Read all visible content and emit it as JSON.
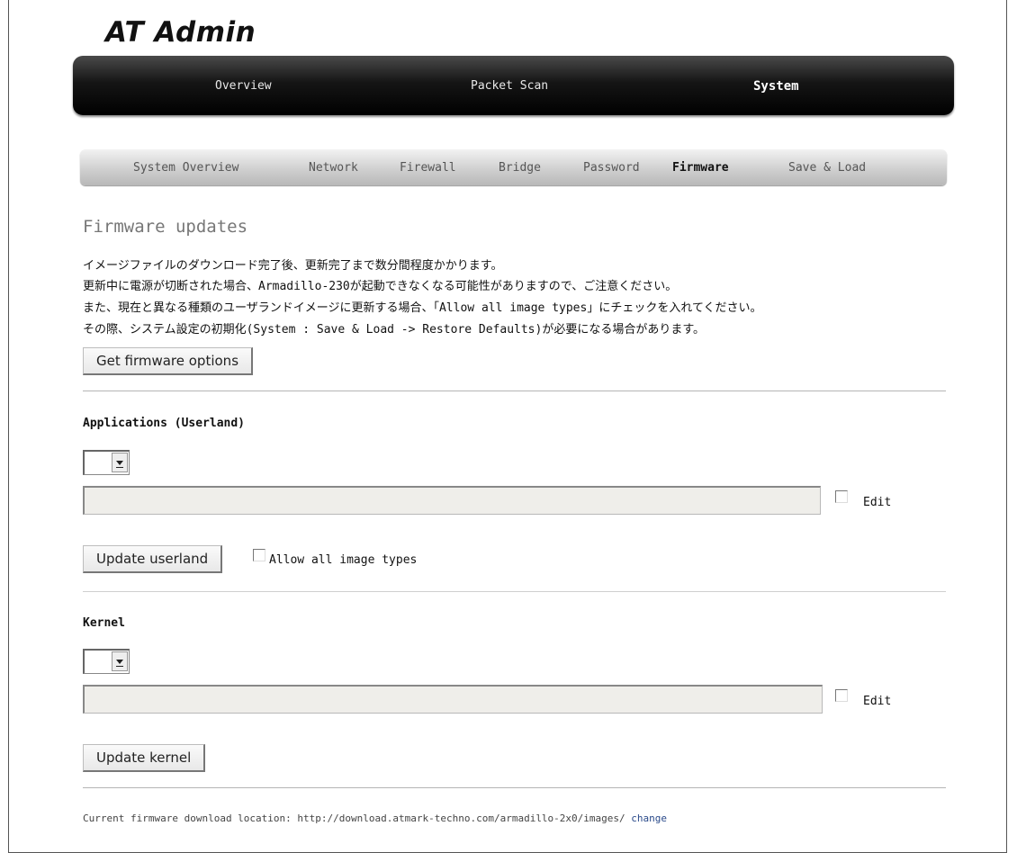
{
  "app": {
    "logo": "AT Admin"
  },
  "top_nav": [
    {
      "label": "Overview",
      "active": false
    },
    {
      "label": "Packet Scan",
      "active": false
    },
    {
      "label": "System",
      "active": true
    }
  ],
  "sub_nav": [
    {
      "label": "System Overview",
      "active": false
    },
    {
      "label": "Network",
      "active": false
    },
    {
      "label": "Firewall",
      "active": false
    },
    {
      "label": "Bridge",
      "active": false
    },
    {
      "label": "Password",
      "active": false
    },
    {
      "label": "Firmware",
      "active": true
    },
    {
      "label": "Save & Load",
      "active": false
    }
  ],
  "firmware": {
    "title": "Firmware updates",
    "description": [
      "イメージファイルのダウンロード完了後、更新完了まで数分間程度かかります。",
      "更新中に電源が切断された場合、Armadillo-230が起動できなくなる可能性がありますので、ご注意ください。",
      "また、現在と異なる種類のユーザランドイメージに更新する場合、「Allow all image types」にチェックを入れてください。",
      "その際、システム設定の初期化(System : Save & Load -> Restore Defaults)が必要になる場合があります。"
    ],
    "get_options_button": "Get firmware options"
  },
  "applications": {
    "heading": "Applications (Userland)",
    "select_value": "",
    "url_value": "",
    "edit_label": "Edit",
    "edit_checked": false,
    "update_button": "Update userland",
    "allow_all_label": "Allow all image types",
    "allow_all_checked": false
  },
  "kernel": {
    "heading": "Kernel",
    "select_value": "",
    "url_value": "",
    "edit_label": "Edit",
    "edit_checked": false,
    "update_button": "Update kernel"
  },
  "footer": {
    "location_text": "Current firmware download location: http://download.atmark-techno.com/armadillo-2x0/images/",
    "change_link": "change"
  },
  "colors": {
    "nav_dark": "#000000",
    "subnav_gray": "#cccccc",
    "link_blue": "#2a4a8a",
    "input_bg": "#efeeea"
  }
}
